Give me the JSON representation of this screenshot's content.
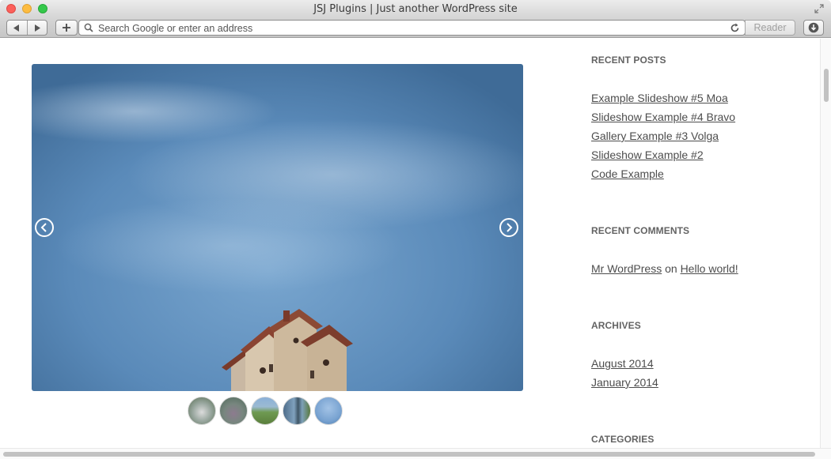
{
  "window": {
    "title": "JSJ Plugins | Just another WordPress site"
  },
  "toolbar": {
    "address_placeholder": "Search Google or enter an address",
    "reader_label": "Reader"
  },
  "slideshow": {
    "thumbnail_count": 5
  },
  "sidebar": {
    "recent_posts": {
      "title": "RECENT POSTS",
      "items": [
        "Example Slideshow #5 Moa",
        "Slideshow Example #4 Bravo",
        "Gallery Example #3 Volga",
        "Slideshow Example #2",
        "Code Example"
      ]
    },
    "recent_comments": {
      "title": "RECENT COMMENTS",
      "author": "Mr WordPress",
      "connector": "on",
      "post": "Hello world!"
    },
    "archives": {
      "title": "ARCHIVES",
      "items": [
        "August 2014",
        "January 2014"
      ]
    },
    "categories": {
      "title": "CATEGORIES"
    }
  },
  "colors": {
    "traffic_close": "#fc605b",
    "traffic_minimize": "#fdbc40",
    "traffic_maximize": "#34c84a",
    "sky_blue": "#5a8ab9",
    "link_text": "#4d4d4d"
  },
  "icons": {
    "back": "chevron-left-icon",
    "forward": "chevron-right-icon",
    "new_tab": "plus-icon",
    "search": "search-icon",
    "reload": "reload-icon",
    "download": "download-icon",
    "fullscreen": "fullscreen-icon",
    "slide_prev": "circle-chevron-left-icon",
    "slide_next": "circle-chevron-right-icon"
  }
}
